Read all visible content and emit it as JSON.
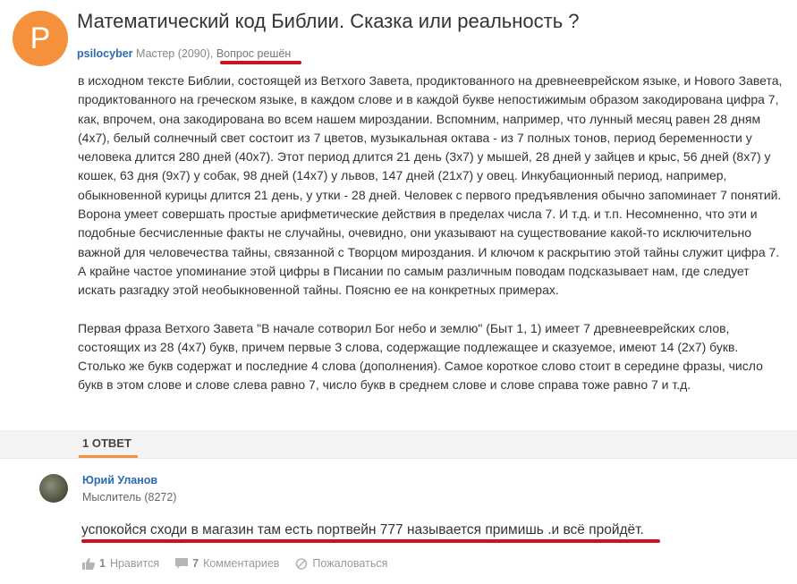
{
  "question": {
    "avatar_letter": "P",
    "title": "Математический код Библии. Сказка или реальность ?",
    "author": "psilocyber",
    "rank": "Мастер (2090),",
    "status": "Вопрос решён",
    "paragraphs": [
      "в исходном тексте Библии, состоящей из Ветхого Завета, продиктованного на древнееврейском языке, и Нового Завета, продиктованного на греческом языке, в каждом слове и в каждой букве непостижимым образом закодирована цифра 7, как, впрочем, она закодирована во всем нашем мироздании. Вспомним, например, что лунный месяц равен 28 дням (4x7), белый солнечный свет состоит из 7 цветов, музыкальная октава - из 7 полных тонов, период беременности у человека длится 280 дней (40x7). Этот период длится 21 день (3x7) у мышей, 28 дней у зайцев и крыс, 56 дней (8x7) у кошек, 63 дня (9x7) у собак, 98 дней (14x7) у львов, 147 дней (21x7) у овец. Инкубационный период, например, обыкновенной курицы длится 21 день, у утки - 28 дней. Человек с первого предъявления обычно запоминает 7 понятий. Ворона умеет совершать простые арифметические действия в пределах числа 7. И т.д. и т.п. Несомненно, что эти и подобные бесчисленные факты не случайны, очевидно, они указывают на существование какой-то исключительно важной для человечества тайны, связанной с Творцом мироздания. И ключом к раскрытию этой тайны служит цифра 7. А крайне частое упоминание этой цифры в Писании по самым различным поводам подсказывает нам, где следует искать разгадку этой необыкновенной тайны. Поясню ее на конкретных примерах.",
      "Первая фраза Ветхого Завета \"В начале сотворил Бог небо и землю\" (Быт 1, 1) имеет 7 древнееврейских слов, состоящих из 28 (4x7) букв, причем первые 3 слова, содержащие подлежащее и сказуемое, имеют 14 (2x7) букв. Столько же букв содержат и последние 4 слова (дополнения). Самое короткое слово стоит в середине фразы, число букв в этом слове и слове слева равно 7, число букв в среднем слове и слове справа тоже равно 7 и т.д."
    ]
  },
  "answers_header": "1 ОТВЕТ",
  "answer": {
    "author": "Юрий Уланов",
    "rank": "Мыслитель (8272)",
    "text": "успокойся сходи в магазин там есть портвейн 777 называется примишь .и всё пройдёт.",
    "likes_count": "1",
    "likes_label": "Нравится",
    "comments_count": "7",
    "comments_label": "Комментариев",
    "report_label": "Пожаловаться"
  },
  "colors": {
    "accent": "#f5913c",
    "link": "#2b6bb3",
    "highlight": "#d01020"
  },
  "icons": [
    "thumbs-up-icon",
    "comment-icon",
    "report-icon"
  ]
}
